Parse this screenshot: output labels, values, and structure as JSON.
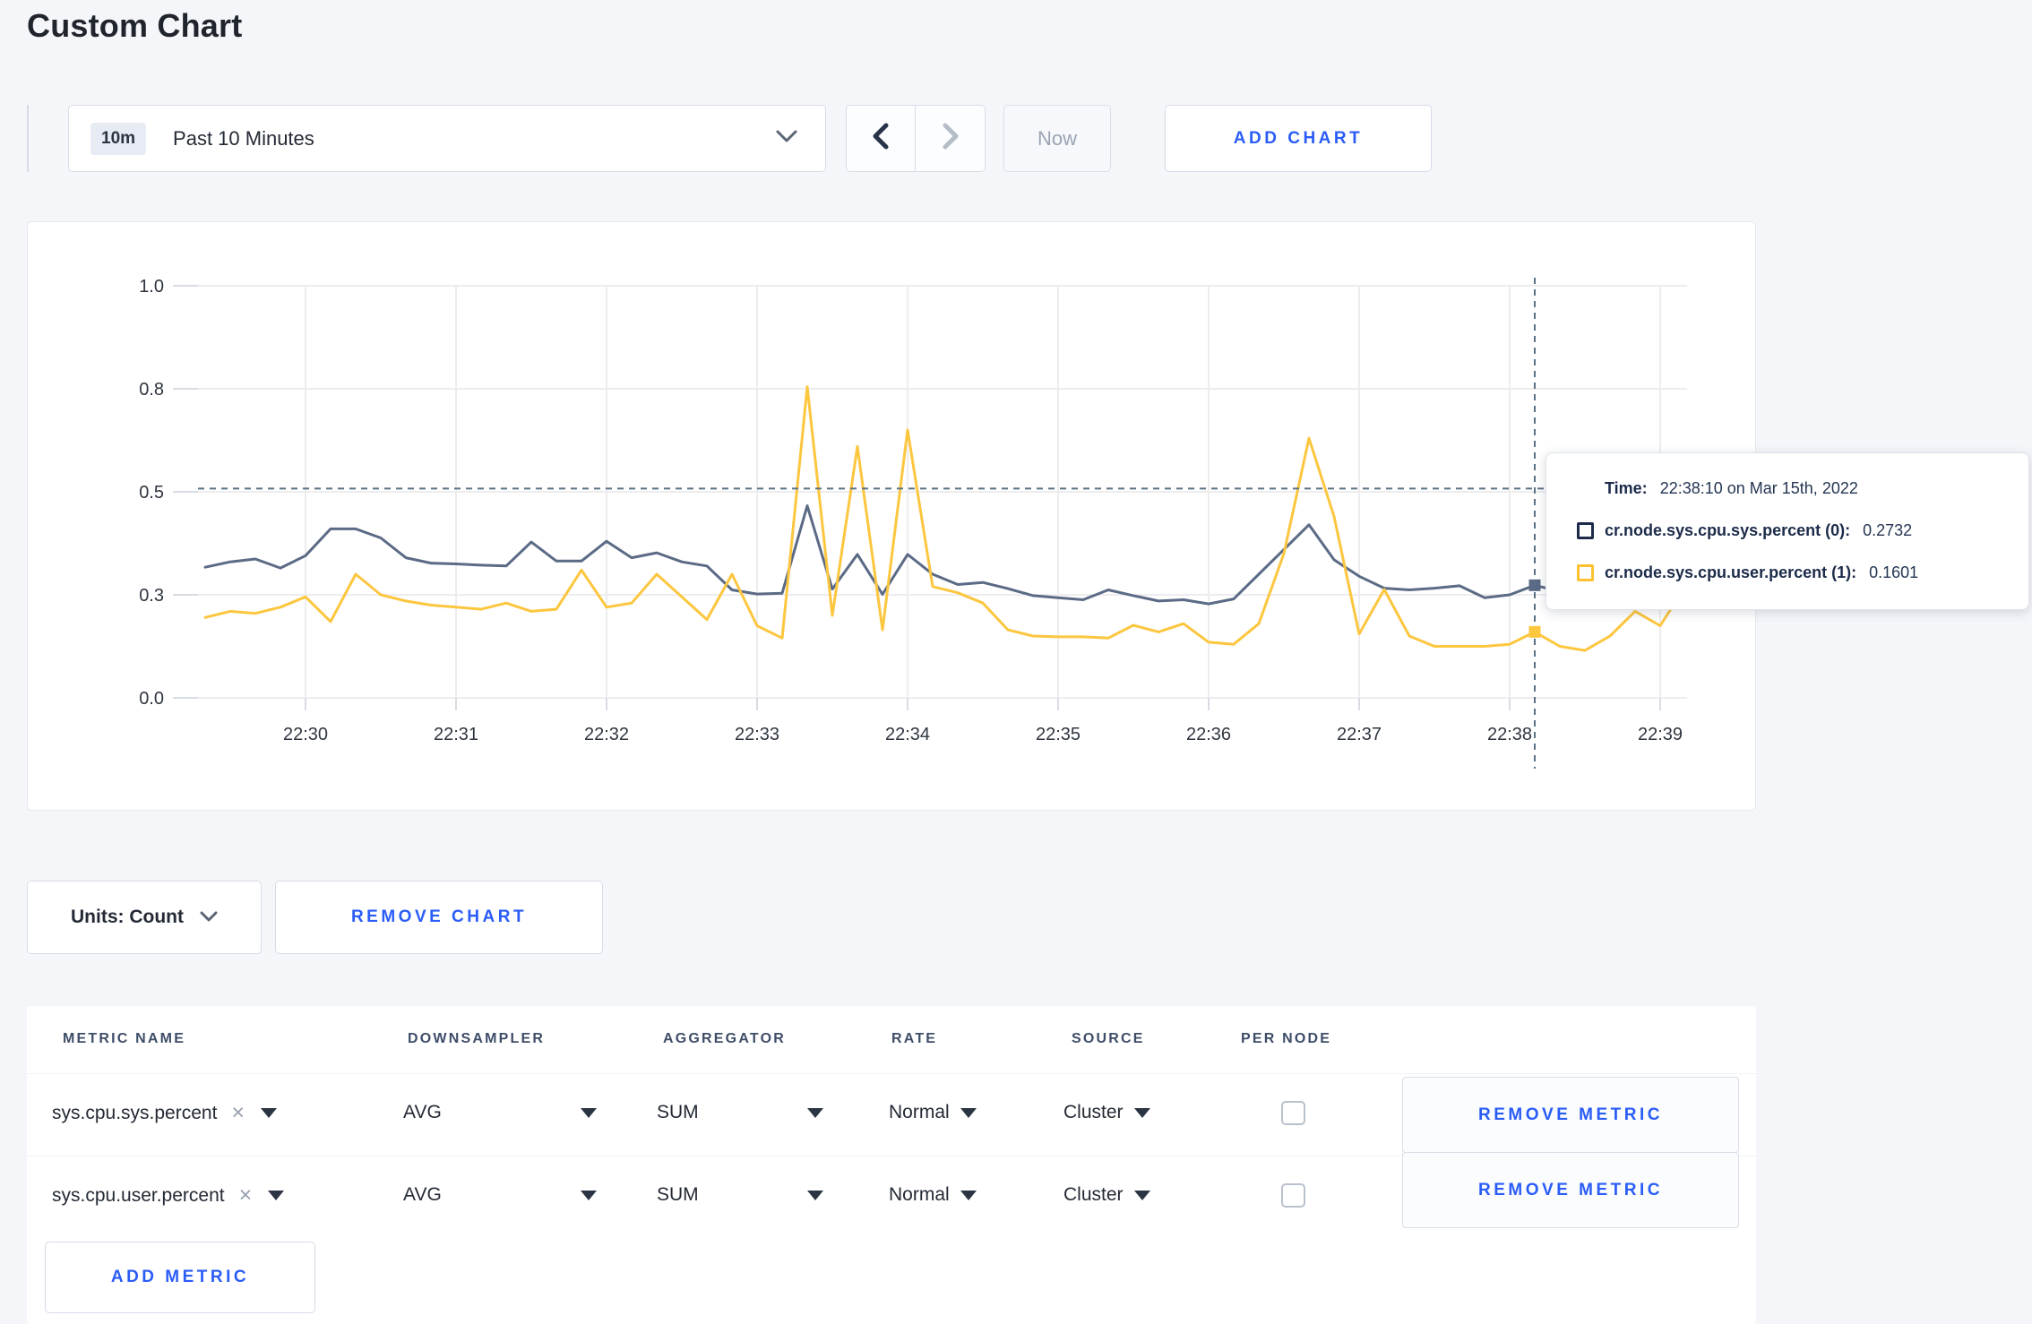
{
  "page": {
    "title": "Custom Chart",
    "background": "#f5f6fa",
    "accent_blue": "#2a5cf7"
  },
  "toolbar": {
    "range_badge": "10m",
    "range_label": "Past 10 Minutes",
    "now_label": "Now",
    "add_chart_label": "ADD CHART",
    "icons": {
      "dropdown": "chevron-down",
      "prev": "chevron-left",
      "next": "chevron-right"
    }
  },
  "chart_data": {
    "type": "line",
    "title": "",
    "xlabel": "",
    "ylabel": "",
    "ylim": [
      0,
      1.0
    ],
    "grid": true,
    "x_ticks": [
      "22:30",
      "22:31",
      "22:32",
      "22:33",
      "22:34",
      "22:35",
      "22:36",
      "22:37",
      "22:38",
      "22:39"
    ],
    "y_ticks": {
      "values": [
        0,
        0.25,
        0.5,
        0.75,
        1.0
      ],
      "labels": [
        "0.0",
        "0.3",
        "0.5",
        "0.8",
        "1.0"
      ]
    },
    "x_start": "22:29:20",
    "x_step_seconds": 10,
    "series": [
      {
        "name": "cr.node.sys.cpu.sys.percent (0)",
        "color": "#5b6a85",
        "values": [
          0.317,
          0.33,
          0.337,
          0.315,
          0.345,
          0.41,
          0.41,
          0.388,
          0.34,
          0.327,
          0.325,
          0.322,
          0.32,
          0.378,
          0.332,
          0.332,
          0.38,
          0.34,
          0.352,
          0.33,
          0.32,
          0.262,
          0.252,
          0.254,
          0.466,
          0.264,
          0.348,
          0.251,
          0.348,
          0.3,
          0.275,
          0.28,
          0.265,
          0.248,
          0.243,
          0.238,
          0.262,
          0.248,
          0.235,
          0.238,
          0.228,
          0.24,
          0.3,
          0.36,
          0.42,
          0.335,
          0.295,
          0.266,
          0.262,
          0.266,
          0.272,
          0.243,
          0.25,
          0.2732,
          0.258,
          0.262,
          0.28,
          0.29,
          0.295,
          0.3
        ]
      },
      {
        "name": "cr.node.sys.cpu.user.percent (1)",
        "color": "#fcc63f",
        "values": [
          0.195,
          0.21,
          0.205,
          0.22,
          0.245,
          0.185,
          0.3,
          0.25,
          0.235,
          0.225,
          0.22,
          0.215,
          0.23,
          0.21,
          0.215,
          0.31,
          0.22,
          0.23,
          0.3,
          0.245,
          0.19,
          0.3,
          0.175,
          0.145,
          0.755,
          0.2,
          0.61,
          0.165,
          0.65,
          0.27,
          0.255,
          0.23,
          0.165,
          0.15,
          0.148,
          0.148,
          0.145,
          0.176,
          0.16,
          0.18,
          0.135,
          0.13,
          0.18,
          0.35,
          0.63,
          0.44,
          0.155,
          0.263,
          0.15,
          0.125,
          0.125,
          0.125,
          0.13,
          0.1601,
          0.125,
          0.115,
          0.15,
          0.21,
          0.175,
          0.27
        ]
      }
    ],
    "crosshair": {
      "x_index": 53,
      "y_value": 0.508,
      "color": "#5b7183"
    },
    "hover_points": [
      {
        "series": 0,
        "value": 0.2732
      },
      {
        "series": 1,
        "value": 0.1601
      }
    ],
    "legend_position": "tooltip"
  },
  "tooltip": {
    "time_label": "Time:",
    "time_value": "22:38:10 on Mar 15th, 2022",
    "rows": [
      {
        "metric": "cr.node.sys.cpu.sys.percent (0):",
        "value": "0.2732",
        "color": "#1c2b4a"
      },
      {
        "metric": "cr.node.sys.cpu.user.percent (1):",
        "value": "0.1601",
        "color": "#fdc131"
      }
    ]
  },
  "units_row": {
    "units_label": "Units: Count",
    "remove_chart_label": "REMOVE CHART"
  },
  "metrics_table": {
    "headers": [
      "METRIC NAME",
      "DOWNSAMPLER",
      "AGGREGATOR",
      "RATE",
      "SOURCE",
      "PER NODE"
    ],
    "clear_icon": "×",
    "rows": [
      {
        "name": "sys.cpu.sys.percent",
        "downsampler": "AVG",
        "aggregator": "SUM",
        "rate": "Normal",
        "source": "Cluster",
        "per_node_checked": false,
        "remove_label": "REMOVE METRIC"
      },
      {
        "name": "sys.cpu.user.percent",
        "downsampler": "AVG",
        "aggregator": "SUM",
        "rate": "Normal",
        "source": "Cluster",
        "per_node_checked": false,
        "remove_label": "REMOVE METRIC"
      }
    ],
    "add_metric_label": "ADD METRIC"
  }
}
